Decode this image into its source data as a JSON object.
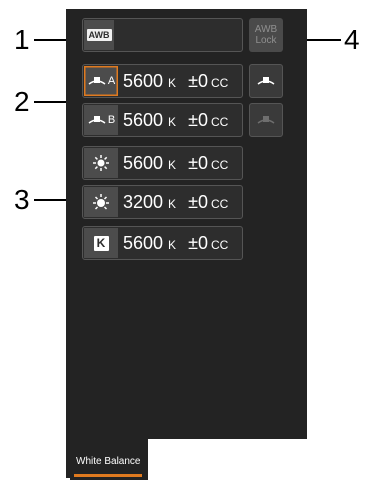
{
  "callouts": [
    "1",
    "2",
    "3",
    "4"
  ],
  "awb_button": {
    "icon": "awb-icon",
    "label": "AWB"
  },
  "awb_lock": {
    "line1": "AWB",
    "line2": "Lock"
  },
  "set_rows": [
    {
      "icon": "custom-wb-a-icon",
      "suffix": "A",
      "temp": "5600",
      "unit": "K",
      "offset": "±0",
      "cc": "CC"
    },
    {
      "icon": "custom-wb-b-icon",
      "suffix": "B",
      "temp": "5600",
      "unit": "K",
      "offset": "±0",
      "cc": "CC"
    }
  ],
  "preset_rows": [
    {
      "icon": "daylight-icon",
      "temp": "5600",
      "unit": "K",
      "offset": "±0",
      "cc": "CC"
    },
    {
      "icon": "tungsten-icon",
      "temp": "3200",
      "unit": "K",
      "offset": "±0",
      "cc": "CC"
    },
    {
      "icon": "kelvin-icon",
      "label": "K",
      "temp": "5600",
      "unit": "K",
      "offset": "±0",
      "cc": "CC"
    }
  ],
  "side_buttons": [
    {
      "icon": "set-wb-icon"
    },
    {
      "icon": "set-wb-icon"
    }
  ],
  "tab": {
    "label": "White Balance"
  },
  "colors": {
    "panel": "#232323",
    "accent": "#e07a1f",
    "button_border": "#555555"
  }
}
